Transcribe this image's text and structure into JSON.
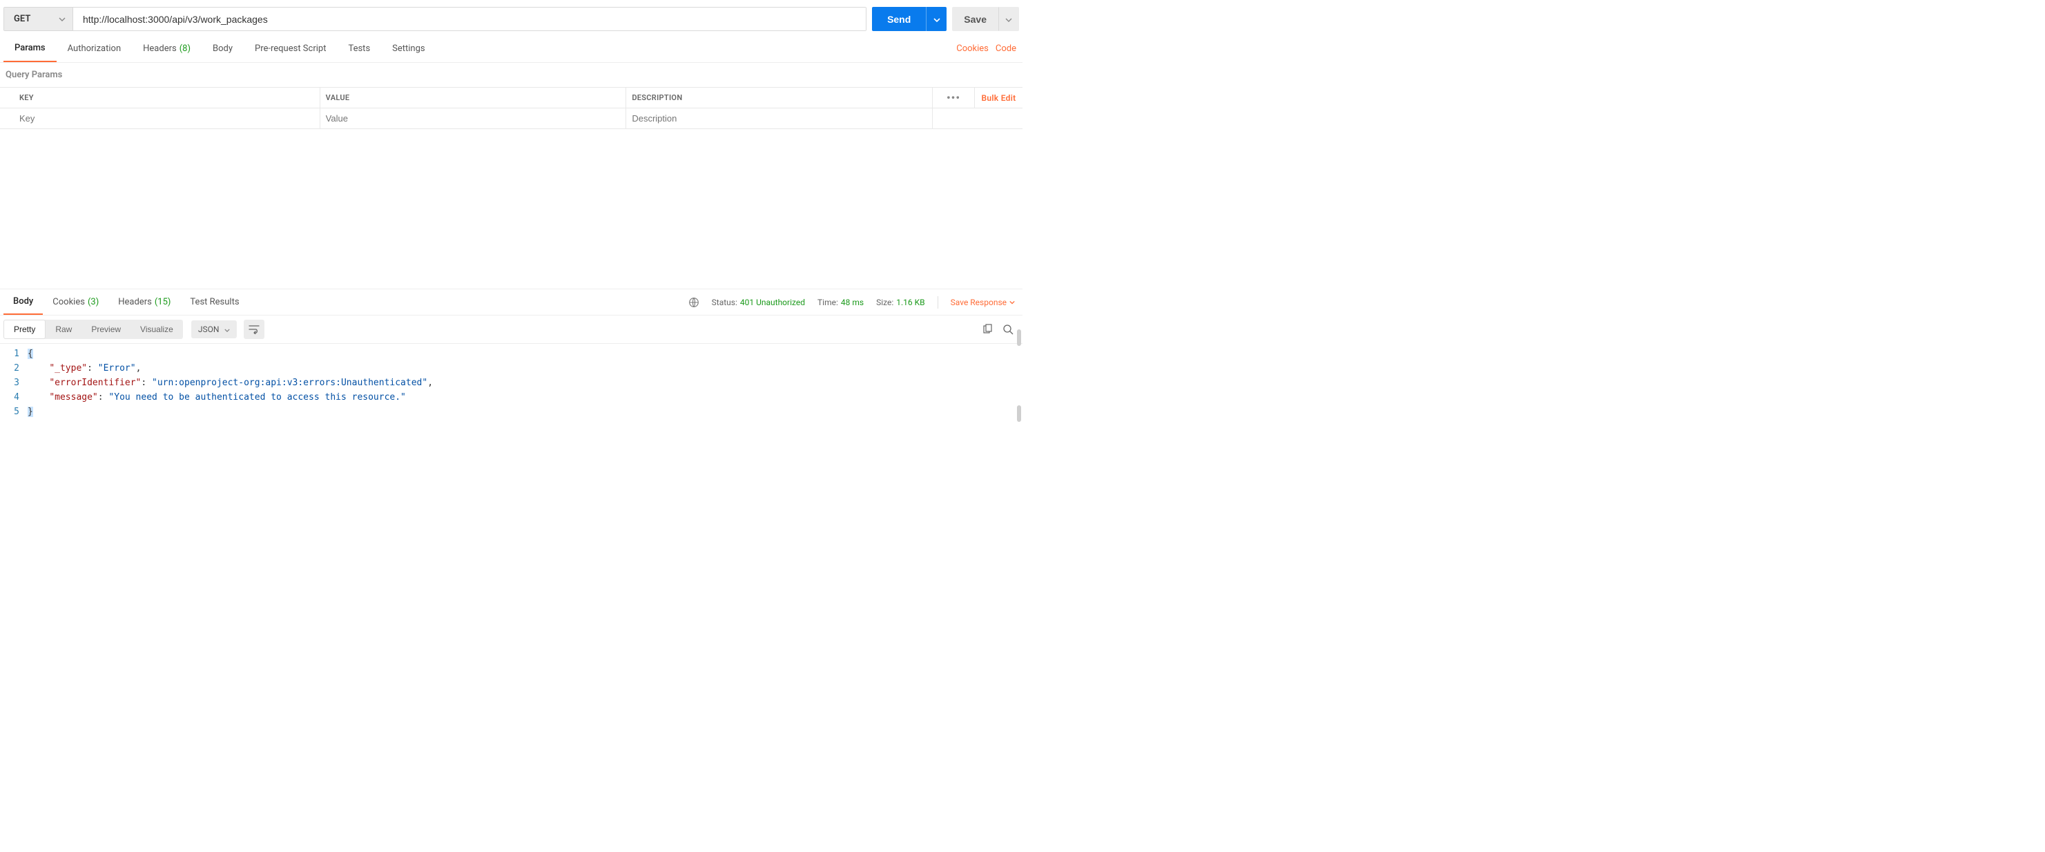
{
  "request": {
    "method": "GET",
    "url": "http://localhost:3000/api/v3/work_packages",
    "send_label": "Send",
    "save_label": "Save"
  },
  "req_tabs": {
    "params": "Params",
    "authorization": "Authorization",
    "headers": "Headers",
    "headers_count": "(8)",
    "body": "Body",
    "prerequest": "Pre-request Script",
    "tests": "Tests",
    "settings": "Settings",
    "cookies": "Cookies",
    "code": "Code"
  },
  "query_params": {
    "title": "Query Params",
    "col_key": "KEY",
    "col_value": "VALUE",
    "col_description": "DESCRIPTION",
    "bulk_edit": "Bulk Edit",
    "placeholder_key": "Key",
    "placeholder_value": "Value",
    "placeholder_description": "Description"
  },
  "resp_tabs": {
    "body": "Body",
    "cookies": "Cookies",
    "cookies_count": "(3)",
    "headers": "Headers",
    "headers_count": "(15)",
    "test_results": "Test Results"
  },
  "resp_meta": {
    "status_label": "Status:",
    "status_value": "401 Unauthorized",
    "time_label": "Time:",
    "time_value": "48 ms",
    "size_label": "Size:",
    "size_value": "1.16 KB",
    "save_response": "Save Response"
  },
  "views": {
    "pretty": "Pretty",
    "raw": "Raw",
    "preview": "Preview",
    "visualize": "Visualize",
    "format": "JSON"
  },
  "json_body": {
    "lines": [
      "1",
      "2",
      "3",
      "4",
      "5"
    ],
    "k_type": "\"_type\"",
    "v_type": "\"Error\"",
    "k_errid": "\"errorIdentifier\"",
    "v_errid": "\"urn:openproject-org:api:v3:errors:Unauthenticated\"",
    "k_msg": "\"message\"",
    "v_msg": "\"You need to be authenticated to access this resource.\""
  }
}
